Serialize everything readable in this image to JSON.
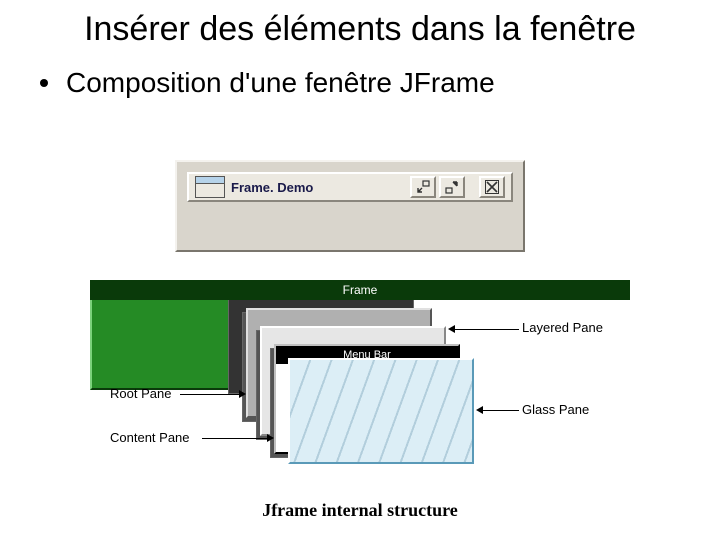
{
  "title": "Insérer des éléments dans la fenêtre",
  "bullet": "Composition d'une fenêtre JFrame",
  "demo": {
    "window_title": "Frame. Demo",
    "icons": {
      "app": "window-icon",
      "iconify": "iconify-icon",
      "maximize": "maximize-icon",
      "close": "close-icon"
    }
  },
  "layers": {
    "frame": "Frame",
    "menu_bar": "Menu Bar"
  },
  "labels": {
    "layered_pane": "Layered Pane",
    "root_pane": "Root Pane",
    "content_pane": "Content Pane",
    "glass_pane": "Glass Pane"
  },
  "caption": "Jframe internal structure"
}
